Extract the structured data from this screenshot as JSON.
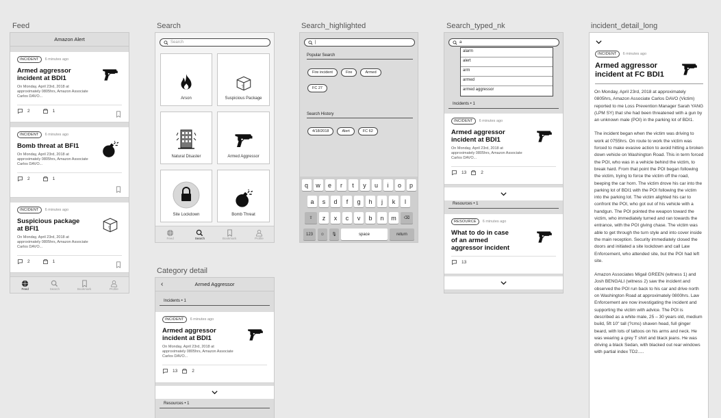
{
  "artboards": {
    "feed": "Feed",
    "search": "Search",
    "search_highlighted": "Search_highlighted",
    "search_typed": "Search_typed_nk",
    "incident_detail": "incident_detail_long",
    "category_detail": "Category detail"
  },
  "feed": {
    "header": "Amazon Alert",
    "cards": [
      {
        "badge": "INCIDENT",
        "time": "6 minutes ago",
        "title": "Armed aggressor incident at BDI1",
        "snippet": "On Monday, April 23rd, 2018 at approximately 0805hrs, Amazon Associate Carlos DAVO...",
        "comments": "2",
        "views": "1",
        "icon": "gun-icon"
      },
      {
        "badge": "INCIDENT",
        "time": "6 minutes ago",
        "title": "Bomb threat at BFI1",
        "snippet": "On Monday, April 23rd, 2018 at approximately 0805hrs, Amazon Associate Carlos DAVO...",
        "comments": "2",
        "views": "1",
        "icon": "bomb-icon"
      },
      {
        "badge": "INCIDENT",
        "time": "6 minutes ago",
        "title": "Suspicious package at BFI1",
        "snippet": "On Monday, April 23rd, 2018 at approximately 0805hrs, Amazon Associate Carlos DAVO...",
        "comments": "2",
        "views": "1",
        "icon": "package-icon"
      }
    ]
  },
  "tabs": [
    "Feed",
    "Search",
    "Bookmark",
    "Profile"
  ],
  "search": {
    "placeholder": "Search",
    "categories": [
      "Arson",
      "Suspicious Package",
      "Natural Disaster",
      "Armed Aggressor",
      "Site Lockdown",
      "Bomb Threat"
    ]
  },
  "search_highlighted": {
    "input": "|",
    "popular_label": "Popular Search",
    "popular": [
      "Fire incident",
      "Fire",
      "Armed",
      "FC 27"
    ],
    "history_label": "Search History",
    "history": [
      "4/18/2018",
      "Alert",
      "FC 62"
    ],
    "keyboard": {
      "row1": [
        "q",
        "w",
        "e",
        "r",
        "t",
        "y",
        "u",
        "i",
        "o",
        "p"
      ],
      "row2": [
        "a",
        "s",
        "d",
        "f",
        "g",
        "h",
        "j",
        "k",
        "l"
      ],
      "row3": [
        "z",
        "x",
        "c",
        "v",
        "b",
        "n",
        "m"
      ],
      "num": "123",
      "space": "space",
      "return": "return"
    }
  },
  "search_typed": {
    "input": "a",
    "suggestions": [
      "alarm",
      "alert",
      "arm",
      "armed",
      "armed aggressor"
    ],
    "incidents_label": "Incidents • 1",
    "resources_label": "Resources • 1",
    "incident_card": {
      "badge": "INCIDENT",
      "time": "6 minutes ago",
      "title": "Armed aggressor incident at BDI1",
      "snippet": "On Monday, April 23rd, 2018 at approximately 0805hrs, Amazon Associate Carlos DAVO...",
      "comments": "13",
      "views": "2"
    },
    "resource_card": {
      "badge": "RESOURCE",
      "time": "6 minutes ago",
      "title": "What to do in case of an armed aggressor incident",
      "comments": "13"
    }
  },
  "incident_detail": {
    "badge": "INCIDENT",
    "time": "6 minutes ago",
    "title": "Armed aggressor incident at FC BDI1",
    "paragraphs": [
      "On Monday, April 23rd, 2018 at approximately 0805hrs, Amazon Associate Carlos DAVO (Victim) reported to me Loss Prevention Manager Sarah YANG (LPM SY) that she had been threatened with a gun by an unknown male (POI) in the parking lot of BDI1.",
      "The incident began when the victim was driving to work at 0755hrs. On route to work the victim was forced to make evasive action to avoid hitting a broken down vehicle on Washington Road. This in term forced the POI, who was in a vehicle behind the victim, to break hard. From that point the POI began following the victim, trying to force the victim off the road, beeping the car horn. The victim drove his car into the parking lot of BDI1 with the POI following the victim into the parking lot. The victim alighted his car to confront the POI, who got out of his vehicle with a handgun. The POI pointed the weapon toward the victim, who immediately turned and ran towards the entrance, with the POI giving chase. The victim was able to get through the turn style and into cover inside the main reception. Security immediately closed the doors and initiated a site lockdown and call Law Enforcement, who attended site, but the POI had left site.",
      "Amazon Associates Migail GREEN (witness 1) and Josh BENGALI (witness 2) saw the incident and observed the POI run back to his car and drive north on Washington Road at approximately 0800hrs. Law Enforcement are now investigating the incident and supporting the victim with advice. The POI is described as a white male, 25 – 30 years old, medium build, 5ft 10\" tall (?cms) shaven head, full ginger beard, with lots of tattoos on his arms and neck. He was wearing a grey T shirt and black jeans. He was driving a black Sedan, with blacked out rear windows with partial index TD2....."
    ]
  },
  "category_detail": {
    "title": "Armed Aggressor",
    "incidents_label": "Incidents • 1",
    "resources_label": "Resources • 1",
    "card": {
      "badge": "INCIDENT",
      "time": "6 minutes ago",
      "title": "Armed aggressor incident at BDI1",
      "snippet": "On Monday, April 23rd, 2018 at approximately 0805hrs, Amazon Associate Carlos DAVO...",
      "comments": "13",
      "views": "2"
    }
  }
}
